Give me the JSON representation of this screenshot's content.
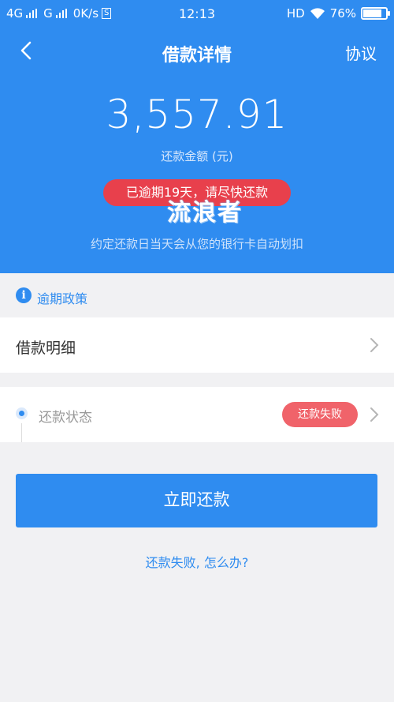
{
  "status_bar": {
    "left": [
      "4G",
      "G",
      "0K/s"
    ],
    "sim_icon_letter": "S",
    "time": "12:13",
    "hd": "HD",
    "battery": "76%",
    "battery_level": 0.76
  },
  "nav": {
    "title": "借款详情",
    "right_label": "协议"
  },
  "summary": {
    "amount": "3,557.91",
    "amount_label": "还款金额 (元)",
    "overdue_badge": "已逾期19天，请尽快还款",
    "watermark": "流浪者",
    "note": "约定还款日当天会从您的银行卡自动划扣"
  },
  "policy": {
    "label": "逾期政策"
  },
  "detail": {
    "label": "借款明细"
  },
  "repay_status": {
    "label": "还款状态",
    "badge": "还款失败"
  },
  "actions": {
    "repay_button": "立即还款",
    "help_link": "还款失败, 怎么办?"
  },
  "colors": {
    "primary": "#2f8cf0",
    "danger": "#e8404c",
    "badge_fail": "#f0636a",
    "background": "#f1f1f3"
  }
}
